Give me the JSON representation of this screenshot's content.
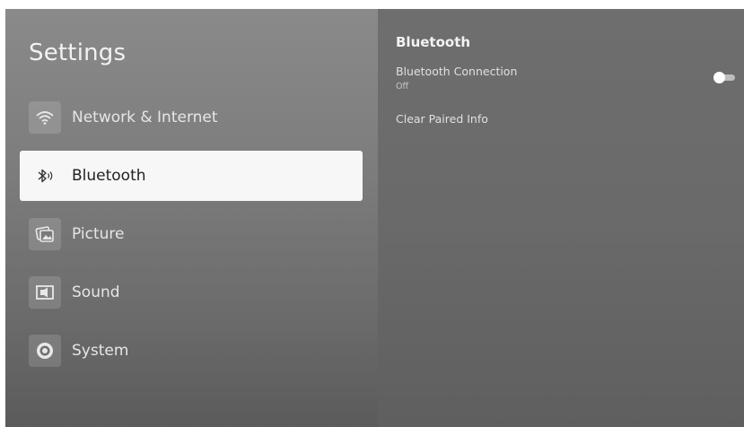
{
  "settings": {
    "title": "Settings",
    "menu": [
      {
        "label": "Network & Internet",
        "icon": "wifi-icon",
        "selected": false
      },
      {
        "label": "Bluetooth",
        "icon": "bluetooth-icon",
        "selected": true
      },
      {
        "label": "Picture",
        "icon": "picture-icon",
        "selected": false
      },
      {
        "label": "Sound",
        "icon": "sound-icon",
        "selected": false
      },
      {
        "label": "System",
        "icon": "system-icon",
        "selected": false
      }
    ]
  },
  "detail": {
    "title": "Bluetooth",
    "connection": {
      "label": "Bluetooth Connection",
      "status": "Off",
      "enabled": false
    },
    "clear_paired_label": "Clear Paired Info"
  },
  "colors": {
    "selected_bg": "#f7f7f7",
    "panel_left": "#7c7c7c",
    "panel_right": "#6a6a6a",
    "text_light": "#e6e6e6"
  }
}
